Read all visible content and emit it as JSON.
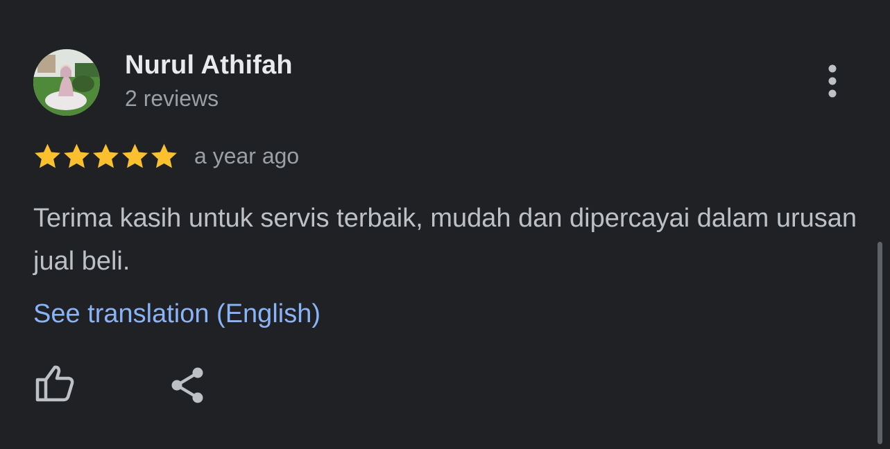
{
  "review": {
    "author": {
      "name": "Nurul Athifah",
      "meta": "2 reviews",
      "avatar_icon": "profile-photo"
    },
    "rating": 5,
    "rating_max": 5,
    "time": "a year ago",
    "text": "Terima kasih untuk servis terbaik, mudah dan dipercayai dalam urusan jual beli.",
    "translate_link": "See translation (English)",
    "actions": {
      "like_icon": "thumbs-up-icon",
      "share_icon": "share-icon",
      "more_icon": "more-vert-icon"
    }
  },
  "colors": {
    "background": "#202124",
    "star": "#fbc02d",
    "link": "#8ab4f8",
    "primary_text": "#e8eaed",
    "secondary_text": "#9aa0a6"
  }
}
